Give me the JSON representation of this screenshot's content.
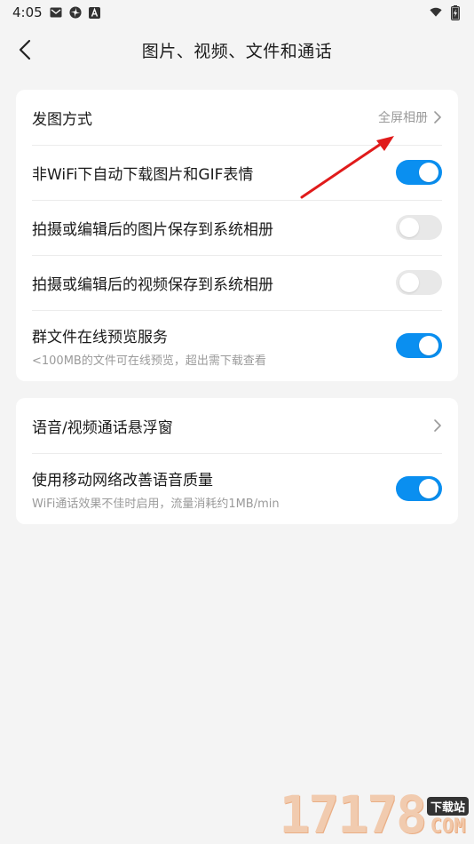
{
  "status_bar": {
    "time": "4:05",
    "left_icons": [
      "mail-icon",
      "pinwheel-icon",
      "a-badge-icon"
    ],
    "right_icons": [
      "wifi-icon",
      "battery-charging-icon"
    ]
  },
  "nav": {
    "title": "图片、视频、文件和通话"
  },
  "card1": {
    "rows": [
      {
        "title": "发图方式",
        "value": "全屏相册",
        "type": "chevron"
      },
      {
        "title": "非WiFi下自动下载图片和GIF表情",
        "type": "toggle",
        "on": true
      },
      {
        "title": "拍摄或编辑后的图片保存到系统相册",
        "type": "toggle",
        "on": false
      },
      {
        "title": "拍摄或编辑后的视频保存到系统相册",
        "type": "toggle",
        "on": false
      },
      {
        "title": "群文件在线预览服务",
        "subtitle": "<100MB的文件可在线预览，超出需下载查看",
        "type": "toggle",
        "on": true
      }
    ]
  },
  "card2": {
    "rows": [
      {
        "title": "语音/视频通话悬浮窗",
        "type": "chevron"
      },
      {
        "title": "使用移动网络改善语音质量",
        "subtitle": "WiFi通话效果不佳时启用，流量消耗约1MB/min",
        "type": "toggle",
        "on": true
      }
    ]
  },
  "watermark": {
    "digits": "17178",
    "tag": "下载站",
    "suffix": "COM"
  },
  "colors": {
    "toggle_on": "#0a8ff0",
    "toggle_off": "#e8e8e8",
    "annotation_arrow": "#e01b1b",
    "background": "#f4f4f4"
  }
}
